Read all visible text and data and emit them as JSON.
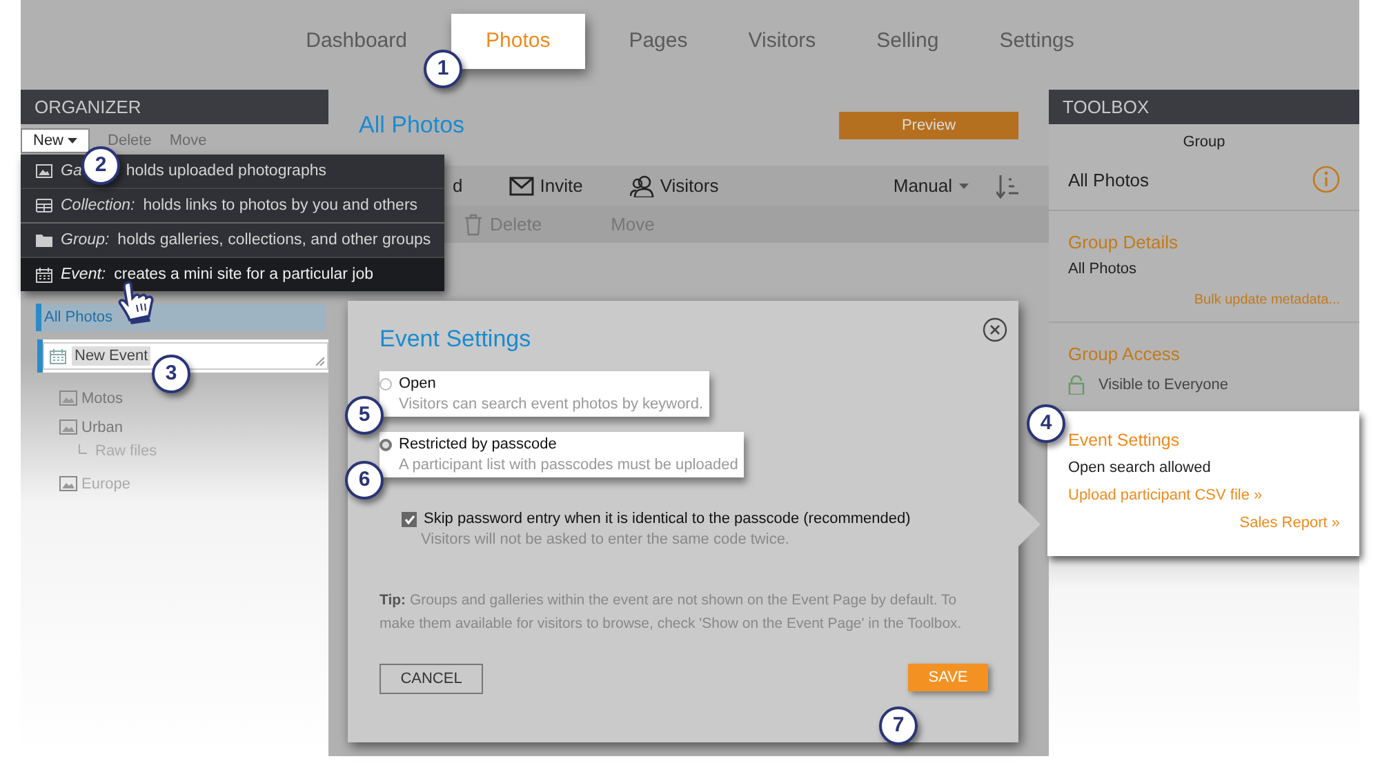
{
  "nav": {
    "tabs": [
      {
        "label": "Dashboard",
        "selected": false
      },
      {
        "label": "Photos",
        "selected": true
      },
      {
        "label": "Pages",
        "selected": false
      },
      {
        "label": "Visitors",
        "selected": false
      },
      {
        "label": "Selling",
        "selected": false
      },
      {
        "label": "Settings",
        "selected": false
      }
    ]
  },
  "organizer": {
    "title": "ORGANIZER",
    "toolbar": [
      {
        "kind": "dropdown",
        "label": "New"
      },
      {
        "kind": "plain",
        "label": "Delete",
        "disabled": true
      },
      {
        "kind": "plain",
        "label": "Move",
        "disabled": true
      }
    ],
    "new_menu": {
      "items": [
        {
          "kind": "gallery",
          "type_label": "Ga",
          "description": "holds uploaded photographs",
          "highlighted": false
        },
        {
          "kind": "collection",
          "type_label": "Collection:",
          "description": "holds links to photos by you and others",
          "highlighted": false
        },
        {
          "kind": "group",
          "type_label": "Group:",
          "description": "holds galleries, collections, and other groups",
          "highlighted": false
        },
        {
          "kind": "event",
          "type_label": "Event:",
          "description": "creates a mini site for a particular job",
          "highlighted": true
        }
      ]
    },
    "tree": [
      {
        "kind": "group",
        "label": "All Photos",
        "selected": true,
        "children": [
          {
            "kind": "input",
            "value": "New Event"
          },
          {
            "kind": "gallery",
            "label": "Motos",
            "selected": false
          },
          {
            "kind": "gallery",
            "label": "Urban",
            "selected": false,
            "children": [
              {
                "kind": "folder",
                "label": "Raw files",
                "selected": false
              }
            ]
          },
          {
            "kind": "gallery",
            "label": "Europe",
            "selected": false
          }
        ]
      }
    ]
  },
  "content": {
    "title": "All Photos",
    "preview_button": "Preview",
    "toolbar": [
      {
        "kind": "text",
        "label": "d"
      },
      {
        "kind": "invite",
        "label": "Invite"
      },
      {
        "kind": "visitors",
        "label": "Visitors"
      }
    ],
    "sort": {
      "label": "Manual"
    },
    "actions": [
      {
        "kind": "delete",
        "label": "Delete",
        "disabled": true
      },
      {
        "kind": "move",
        "label": "Move",
        "disabled": true
      }
    ]
  },
  "dialog": {
    "title": "Event Settings",
    "options": [
      {
        "label": "Open",
        "description": "Visitors can search event photos by keyword.",
        "selected": false
      },
      {
        "label": "Restricted by passcode",
        "description": "A participant list with passcodes must be uploaded",
        "selected": true
      }
    ],
    "checkbox": {
      "label": "Skip password entry when it is identical to the passcode (recommended)",
      "description": "Visitors will not be asked to enter the same code twice.",
      "checked": true
    },
    "tip": "**Tip:** Groups and galleries within the event are not shown on the Event Page by default. To make them available for visitors to browse, check 'Show on the Event Page' in the Toolbox.",
    "buttons": [
      {
        "kind": "cancel",
        "label": "CANCEL"
      },
      {
        "kind": "save",
        "label": "SAVE"
      }
    ]
  },
  "toolbox": {
    "title": "TOOLBOX",
    "type": "Group",
    "name": "All Photos",
    "details": {
      "title": "Group Details",
      "name": "All Photos",
      "link": "Bulk update metadata..."
    },
    "access": {
      "title": "Group Access",
      "visibility": "Visible to Everyone"
    }
  },
  "event_popup": {
    "title": "Event Settings",
    "status": "Open search allowed",
    "links": [
      "Upload participant CSV file »",
      "Sales Report »"
    ]
  },
  "steps": [
    {
      "number": "1",
      "kind": "tab"
    },
    {
      "number": "2",
      "kind": "menu"
    },
    {
      "number": "3",
      "kind": "field"
    },
    {
      "number": "4",
      "kind": "popup"
    },
    {
      "number": "5",
      "kind": "open"
    },
    {
      "number": "6",
      "kind": "restricted"
    },
    {
      "number": "7",
      "kind": "save"
    }
  ]
}
